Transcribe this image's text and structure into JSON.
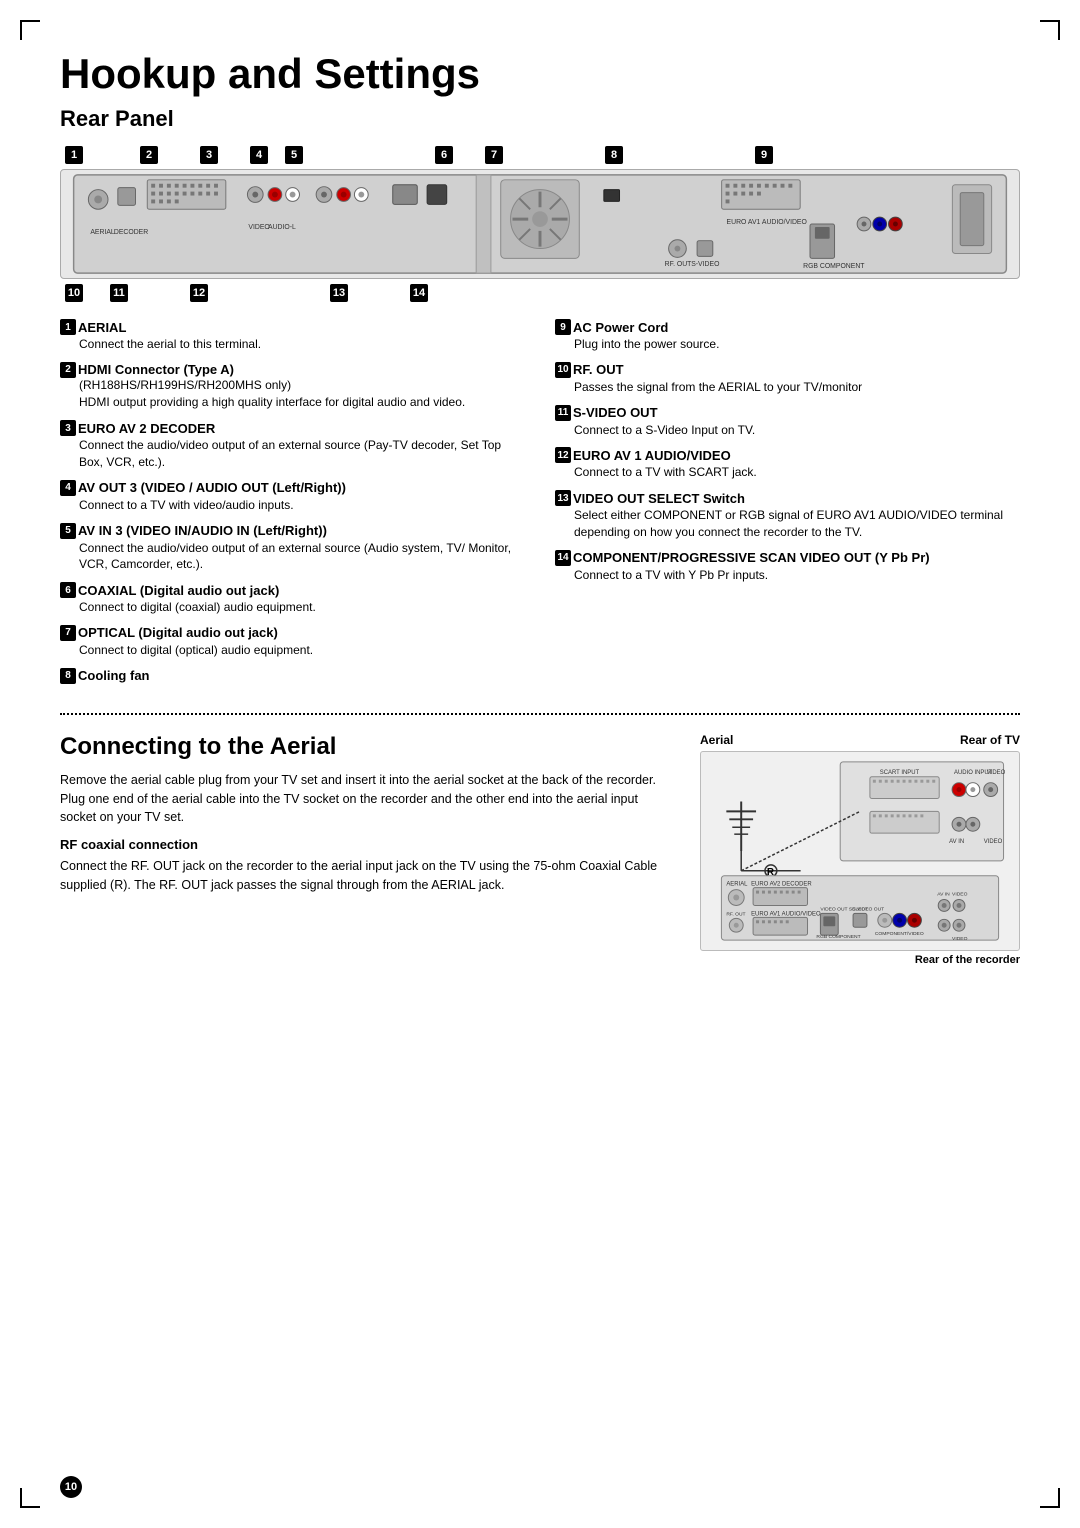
{
  "page": {
    "title": "Hookup and Settings",
    "section1_title": "Rear Panel",
    "section2_title": "Connecting to the Aerial",
    "page_number": "10"
  },
  "diagram": {
    "top_numbers": [
      "1",
      "2",
      "3",
      "4",
      "5",
      "6",
      "7",
      "8",
      "9"
    ],
    "bottom_numbers": [
      "10",
      "11",
      "12",
      "13",
      "14"
    ]
  },
  "descriptions": {
    "left_col": [
      {
        "num": "1",
        "title": "AERIAL",
        "text": "Connect the aerial to this terminal."
      },
      {
        "num": "2",
        "title": "HDMI Connector (Type A)",
        "subtitle": "(RH188HS/RH199HS/RH200MHS only)",
        "text": "HDMI output providing a high quality interface for digital audio and video."
      },
      {
        "num": "3",
        "title": "EURO AV 2 DECODER",
        "text": "Connect the audio/video output of an external source (Pay-TV decoder, Set Top Box, VCR, etc.)."
      },
      {
        "num": "4",
        "title": "AV OUT 3 (VIDEO / AUDIO OUT (Left/Right))",
        "text": "Connect to a TV with video/audio inputs."
      },
      {
        "num": "5",
        "title": "AV IN 3 (VIDEO IN/AUDIO IN (Left/Right))",
        "text": "Connect the audio/video output of an external source (Audio system, TV/ Monitor, VCR, Camcorder, etc.)."
      },
      {
        "num": "6",
        "title": "COAXIAL (Digital audio out jack)",
        "text": "Connect to digital (coaxial) audio equipment."
      },
      {
        "num": "7",
        "title": "OPTICAL (Digital audio out jack)",
        "text": "Connect to digital (optical) audio equipment."
      },
      {
        "num": "8",
        "title": "Cooling fan",
        "text": ""
      }
    ],
    "right_col": [
      {
        "num": "9",
        "title": "AC Power Cord",
        "text": "Plug into the power source."
      },
      {
        "num": "10",
        "title": "RF. OUT",
        "text": "Passes the signal from the AERIAL to your TV/monitor"
      },
      {
        "num": "11",
        "title": "S-VIDEO OUT",
        "text": "Connect to a S-Video Input on TV."
      },
      {
        "num": "12",
        "title": "EURO AV 1 AUDIO/VIDEO",
        "text": "Connect to a TV with SCART jack."
      },
      {
        "num": "13",
        "title": "VIDEO OUT SELECT Switch",
        "text": "Select either COMPONENT or RGB signal of EURO AV1 AUDIO/VIDEO terminal depending on how you connect the recorder to the TV."
      },
      {
        "num": "14",
        "title": "COMPONENT/PROGRESSIVE SCAN VIDEO OUT (Y Pb Pr)",
        "text": "Connect to a TV with Y Pb Pr inputs."
      }
    ]
  },
  "aerial": {
    "title": "Connecting to the Aerial",
    "body": "Remove the aerial cable plug from your TV set and insert it into the aerial socket at the back of the recorder. Plug one end of the aerial cable into the TV socket on the recorder and the other end into the aerial input socket on your TV set.",
    "rf_title": "RF coaxial connection",
    "rf_body": "Connect the RF. OUT jack on the recorder to the aerial input jack on the TV using the 75-ohm Coaxial Cable supplied (R). The RF. OUT jack passes the signal through from the AERIAL jack.",
    "label_aerial": "Aerial",
    "label_rear_tv": "Rear of TV",
    "label_rear_recorder": "Rear of the recorder",
    "label_r": "R"
  }
}
